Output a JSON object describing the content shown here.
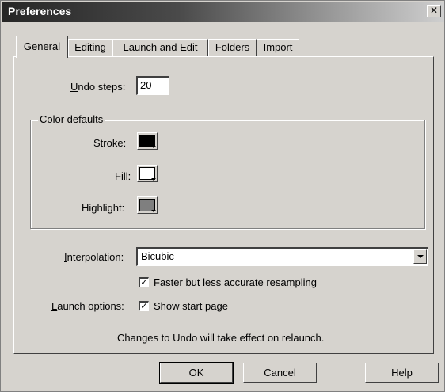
{
  "window": {
    "title": "Preferences",
    "close_glyph": "✕"
  },
  "tabs": [
    {
      "label": "General",
      "active": true
    },
    {
      "label": "Editing",
      "active": false
    },
    {
      "label": "Launch and Edit",
      "active": false
    },
    {
      "label": "Folders",
      "active": false
    },
    {
      "label": "Import",
      "active": false
    }
  ],
  "undo": {
    "label_prefix": "",
    "label_mnemonic": "U",
    "label_rest": "ndo steps:",
    "value": "20"
  },
  "color_defaults": {
    "legend": "Color defaults",
    "stroke": {
      "label": "Stroke:",
      "color": "#000000"
    },
    "fill": {
      "label": "Fill:",
      "color": "#ffffff"
    },
    "highlight": {
      "label": "Highlight:",
      "color": "#7f7f7f"
    }
  },
  "interpolation": {
    "label_mnemonic": "I",
    "label_rest": "nterpolation:",
    "selected": "Bicubic"
  },
  "faster_resampling": {
    "checked": true,
    "label": "Faster but less accurate resampling"
  },
  "launch_options": {
    "label_mnemonic": "L",
    "label_rest": "aunch options:",
    "show_start_page": {
      "checked": true,
      "label": "Show start page"
    }
  },
  "note": "Changes to Undo will take effect on relaunch.",
  "buttons": {
    "ok": "OK",
    "cancel": "Cancel",
    "help": "Help"
  },
  "colors": {
    "dialog_bg": "#d6d3ce",
    "title_fg": "#ffffff"
  },
  "icons": {
    "checkmark": "✓"
  }
}
